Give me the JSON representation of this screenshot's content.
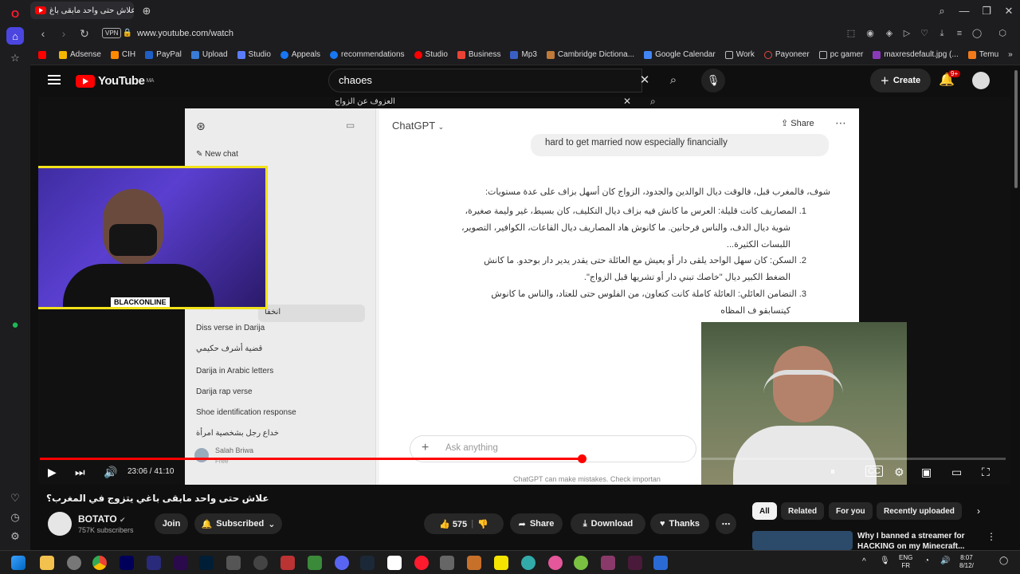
{
  "browser": {
    "tab_title": "(453) علاش حتى واحد مابقى باغ",
    "url": "www.youtube.com/watch",
    "vpn_label": "VPN",
    "bookmarks": [
      "Adsense",
      "CIH",
      "PayPal",
      "Upload",
      "Studio",
      "Appeals",
      "recommendations",
      "Studio",
      "Business",
      "Mp3",
      "Cambridge Dictiona...",
      "Google Calendar",
      "Work",
      "Payoneer",
      "pc gamer",
      "maxresdefault.jpg (...",
      "Temu"
    ]
  },
  "youtube": {
    "logo": "YouTube",
    "region": "MA",
    "search_value": "chaoes",
    "create_label": "Create",
    "notif_badge": "9+"
  },
  "video": {
    "inner_search": "العزوف عن الزواج",
    "chatgpt": {
      "new_chat": "New chat",
      "sidebar_items": [
        "Diss verse in Darija",
        "قضية أشرف حكيمي",
        "Darija in Arabic letters",
        "Darija rap verse",
        "Shoe identification response",
        "خداع رجل بشخصية امرأة"
      ],
      "partial_item": "انخفا",
      "user_name": "Salah Briwa",
      "user_plan": "Free",
      "title": "ChatGPT",
      "share": "Share",
      "user_message": "hard to get married now especially financially",
      "response_intro": "شوف، فالمغرب قبل، فالوقت ديال الوالدين والجدود، الزواج كان أسهل بزاف على عدة مستويات:",
      "response_lines": [
        "1.  المصاريف كانت قليلة: العرس ما كانش فيه بزاف ديال التكليف، كان بسيط، غير وليمة صغيرة،",
        "شوية ديال الدف، والناس فرحانين. ما كانوش هاد المصاريف ديال القاعات، الكوافير، التصوير،",
        "اللبسات الكثيرة...",
        "2.  السكن: كان سهل الواحد يلقى دار أو يعيش مع العائلة حتى يقدر يدير دار بوحدو. ما كانش",
        "الضغط الكبير ديال \"خاصك تبني دار أو تشريها قبل الزواج\".",
        "3.  التضامن العائلي: العائلة كاملة كانت كتعاون، من الفلوس حتى للعتاد، والناس ما كانوش",
        "كيتسابقو ف المظاه"
      ],
      "input_placeholder": "Ask anything",
      "disclaimer": "ChatGPT can make mistakes. Check importan"
    },
    "streamer_label": "BLACKONLINE",
    "time_current": "23:06",
    "time_total": "41:10",
    "progress_fraction": 0.561
  },
  "watch": {
    "title": "علاش حتى واحد مابقى باغي يتزوج في المغرب؟",
    "channel": "BOTATO",
    "subscribers": "757K subscribers",
    "join": "Join",
    "subscribed": "Subscribed",
    "likes": "575",
    "share": "Share",
    "download": "Download",
    "thanks": "Thanks",
    "chips": [
      "All",
      "Related",
      "For you",
      "Recently uploaded"
    ],
    "rec_title": "Why I banned a streamer for HACKING on my Minecraft..."
  },
  "taskbar": {
    "lang_top": "ENG",
    "lang_bottom": "FR",
    "clock_time": "8:07",
    "clock_date": "8/12/"
  },
  "colors": {
    "yt_red": "#ff0000",
    "cam_border": "#f2e21a",
    "bg": "#0f0f0f"
  }
}
